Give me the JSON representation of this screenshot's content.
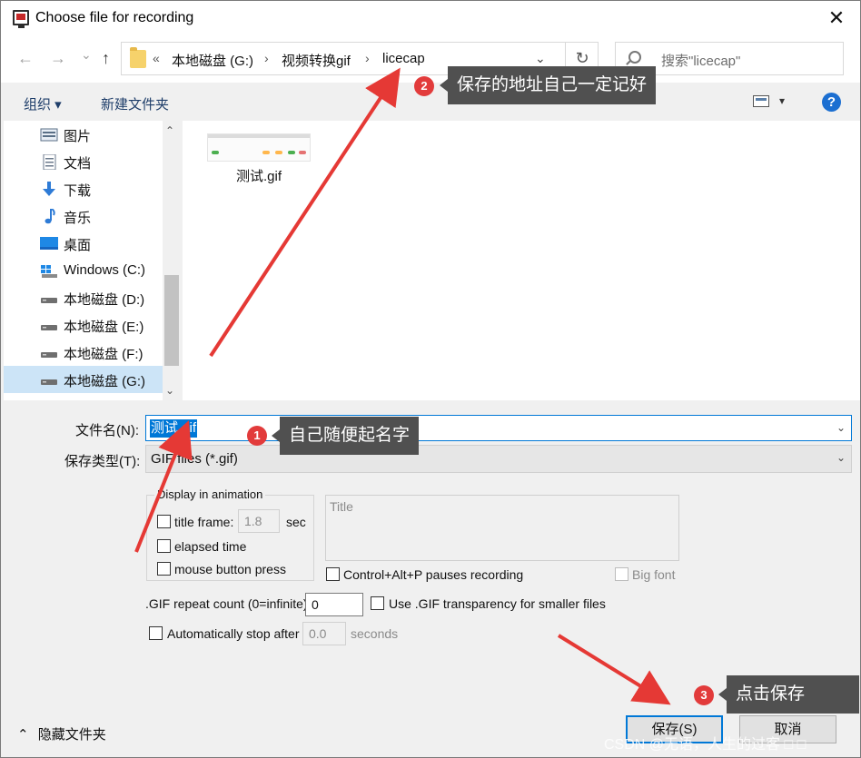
{
  "window": {
    "title": "Choose file for recording",
    "close_glyph": "✕"
  },
  "nav": {
    "back_glyph": "←",
    "forward_glyph": "→",
    "history_glyph": "⌄",
    "up_glyph": "↑",
    "breadcrumb_prefix": "«",
    "breadcrumb": [
      "本地磁盘 (G:)",
      "视频转换gif",
      "licecap"
    ],
    "separator": "›",
    "dropdown_glyph": "⌄",
    "refresh_glyph": "↻",
    "search_placeholder": "搜索\"licecap\""
  },
  "toolbar": {
    "organize": "组织 ▾",
    "new_folder": "新建文件夹",
    "view_dropdown": "▾",
    "help": "?"
  },
  "sidebar": {
    "items": [
      {
        "label": "图片",
        "icon": "pictures-icon"
      },
      {
        "label": "文档",
        "icon": "documents-icon"
      },
      {
        "label": "下载",
        "icon": "downloads-icon"
      },
      {
        "label": "音乐",
        "icon": "music-icon"
      },
      {
        "label": "桌面",
        "icon": "desktop-icon"
      },
      {
        "label": "Windows (C:)",
        "icon": "windows-drive-icon"
      },
      {
        "label": "本地磁盘 (D:)",
        "icon": "drive-icon"
      },
      {
        "label": "本地磁盘 (E:)",
        "icon": "drive-icon"
      },
      {
        "label": "本地磁盘 (F:)",
        "icon": "drive-icon"
      },
      {
        "label": "本地磁盘 (G:)",
        "icon": "drive-icon",
        "selected": true
      }
    ],
    "scroll_up": "⌃",
    "scroll_down": "⌄"
  },
  "files": [
    {
      "name": "测试.gif"
    }
  ],
  "form": {
    "filename_label": "文件名(N):",
    "filename_value": "测试.gif",
    "filetype_label": "保存类型(T):",
    "filetype_value": "GIF files (*.gif)",
    "dropdown_glyph": "⌄"
  },
  "options": {
    "group_title": "Display in animation",
    "title_frame_label": "title frame:",
    "title_frame_value": "1.8",
    "title_frame_unit": "sec",
    "elapsed_time_label": "elapsed time",
    "mouse_button_label": "mouse button press",
    "title_box_label": "Title",
    "pause_label": "Control+Alt+P pauses recording",
    "big_font_label": "Big font",
    "repeat_label": ".GIF repeat count (0=infinite):",
    "repeat_value": "0",
    "transparency_label": "Use .GIF transparency for smaller files",
    "auto_stop_label": "Automatically stop after",
    "auto_stop_value": "0.0",
    "auto_stop_unit": "seconds"
  },
  "footer": {
    "hide_folders": "隐藏文件夹",
    "hide_glyph": "⌃",
    "save": "保存(S)",
    "cancel": "取消"
  },
  "annotations": {
    "callout_1": "自己随便起名字",
    "callout_2": "保存的地址自己一定记好",
    "callout_3": "点击保存",
    "badge_1": "1",
    "badge_2": "2",
    "badge_3": "3",
    "arrow_color": "#e53935"
  },
  "watermark": "CSDN @无语，人生的过客 □ □"
}
